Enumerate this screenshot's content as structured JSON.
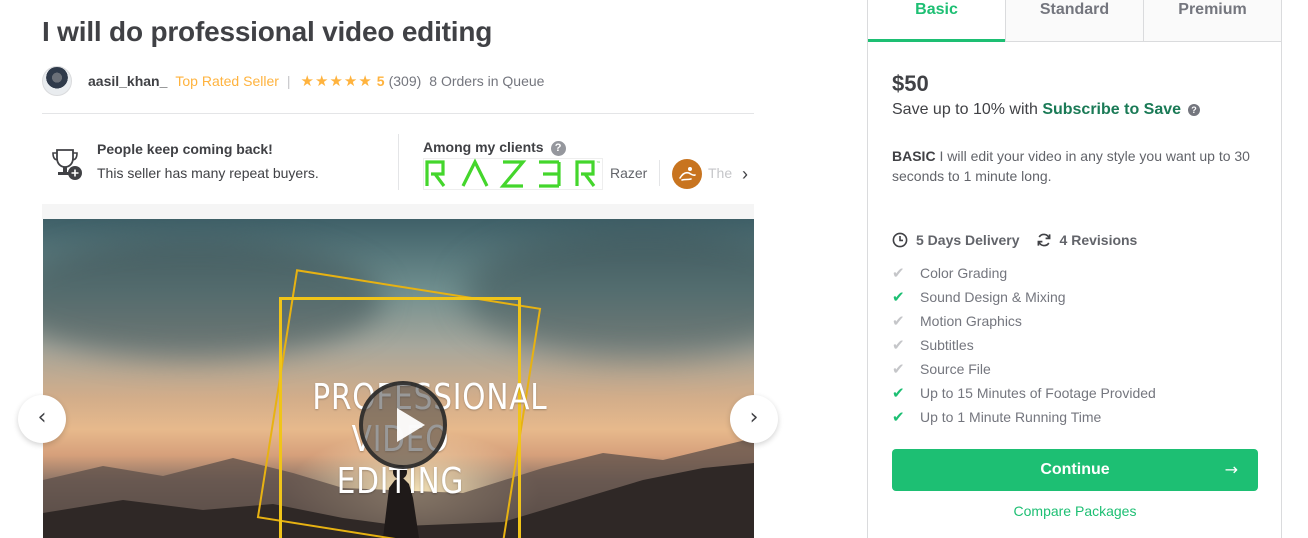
{
  "gig": {
    "title": "I will do professional video editing"
  },
  "seller": {
    "name": "aasil_khan_",
    "level": "Top Rated Seller",
    "separator": "|",
    "stars": "★★★★★",
    "rating": "5",
    "review_count": "(309)",
    "orders_in_queue": "8 Orders in Queue"
  },
  "repeat_buyers": {
    "title": "People keep coming back!",
    "subtitle": "This seller has many repeat buyers.",
    "icon": "trophy-icon"
  },
  "clients": {
    "title": "Among my clients",
    "help": "?",
    "items": [
      {
        "logo_text": "RAZER",
        "name": "Razer",
        "logo_color": "#44d62c"
      },
      {
        "name": "The",
        "logo_color": "#c8741f"
      }
    ],
    "next_icon": "›"
  },
  "media": {
    "overlay_line1": "PROFESSIONAL",
    "overlay_line2": "VIDEO EDITING",
    "frame_color": "#f0c419",
    "play_icon": "play-icon",
    "prev_icon": "‹",
    "next_icon": "›"
  },
  "packages": {
    "tabs": [
      "Basic",
      "Standard",
      "Premium"
    ],
    "active_tab": "Basic",
    "price": "$50",
    "save_prefix": "Save up to 10% with ",
    "save_link": "Subscribe to Save",
    "save_help": "?",
    "desc_label": "BASIC",
    "description": " I will edit your video in any style you want up to 30 seconds to 1 minute long.",
    "delivery": "5 Days Delivery",
    "revisions": "4 Revisions",
    "features": [
      {
        "label": "Color Grading",
        "included": false
      },
      {
        "label": "Sound Design & Mixing",
        "included": true
      },
      {
        "label": "Motion Graphics",
        "included": false
      },
      {
        "label": "Subtitles",
        "included": false
      },
      {
        "label": "Source File",
        "included": false
      },
      {
        "label": "Up to 15 Minutes of Footage Provided",
        "included": true
      },
      {
        "label": "Up to 1 Minute Running Time",
        "included": true
      }
    ],
    "continue_label": "Continue",
    "continue_arrow": "→",
    "compare_label": "Compare Packages",
    "check_glyph": "✔"
  },
  "colors": {
    "accent_green": "#1dbf73",
    "link_green": "#1a7a56",
    "star_gold": "#ffb33e",
    "text_dark": "#404145",
    "text_muted": "#74767e"
  }
}
